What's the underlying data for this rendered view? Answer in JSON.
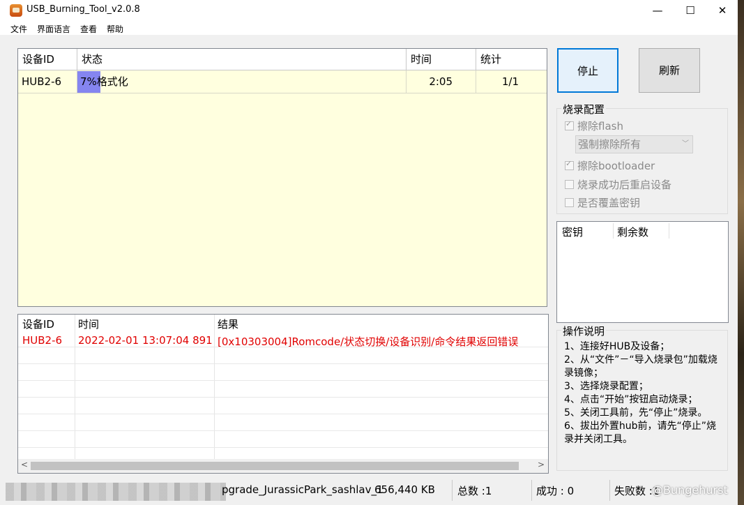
{
  "window": {
    "title": "USB_Burning_Tool_v2.0.8",
    "minimize": "—",
    "maximize": "☐",
    "close": "✕"
  },
  "menu": [
    "文件",
    "界面语言",
    "查看",
    "帮助"
  ],
  "device_table": {
    "headers": [
      "设备ID",
      "状态",
      "时间",
      "统计"
    ],
    "row": {
      "device_id": "HUB2-6",
      "progress_percent": 7,
      "progress_label": "7%",
      "status": "格式化",
      "time": "2:05",
      "count": "1/1"
    }
  },
  "log_table": {
    "headers": [
      "设备ID",
      "时间",
      "结果"
    ],
    "rows": [
      {
        "device_id": "HUB2-6",
        "time": "2022-02-01 13:07:04 891",
        "result": "[0x10303004]Romcode/状态切换/设备识别/命令结果返回错误"
      }
    ],
    "scroll_left": "<",
    "scroll_right": ">"
  },
  "buttons": {
    "stop": "停止",
    "refresh": "刷新"
  },
  "burn_config": {
    "title": "烧录配置",
    "erase_flash": {
      "label": "擦除flash",
      "checked": true
    },
    "erase_mode": "强制擦除所有",
    "erase_bootloader": {
      "label": "擦除bootloader",
      "checked": true
    },
    "reboot_after": {
      "label": "烧录成功后重启设备",
      "checked": false
    },
    "overwrite_key": {
      "label": "是否覆盖密钥",
      "checked": false
    }
  },
  "key_table": {
    "headers": [
      "密钥",
      "剩余数"
    ]
  },
  "instructions": {
    "title": "操作说明",
    "lines": [
      "1、连接好HUB及设备；",
      "2、从“文件”－“导入烧录包”加载烧录镜像；",
      "3、选择烧录配置；",
      "4、点击“开始”按钮启动烧录；",
      "5、关闭工具前，先“停止”烧录。",
      "6、拔出外置hub前，请先“停止”烧录并关闭工具。"
    ]
  },
  "statusbar": {
    "file": "pgrade_JurassicPark_sashlav_1",
    "size": "656,440 KB",
    "total": "总数 :1",
    "success": "成功 :  0",
    "fail": "失败数 :1"
  },
  "watermark": "@Bungehurst"
}
